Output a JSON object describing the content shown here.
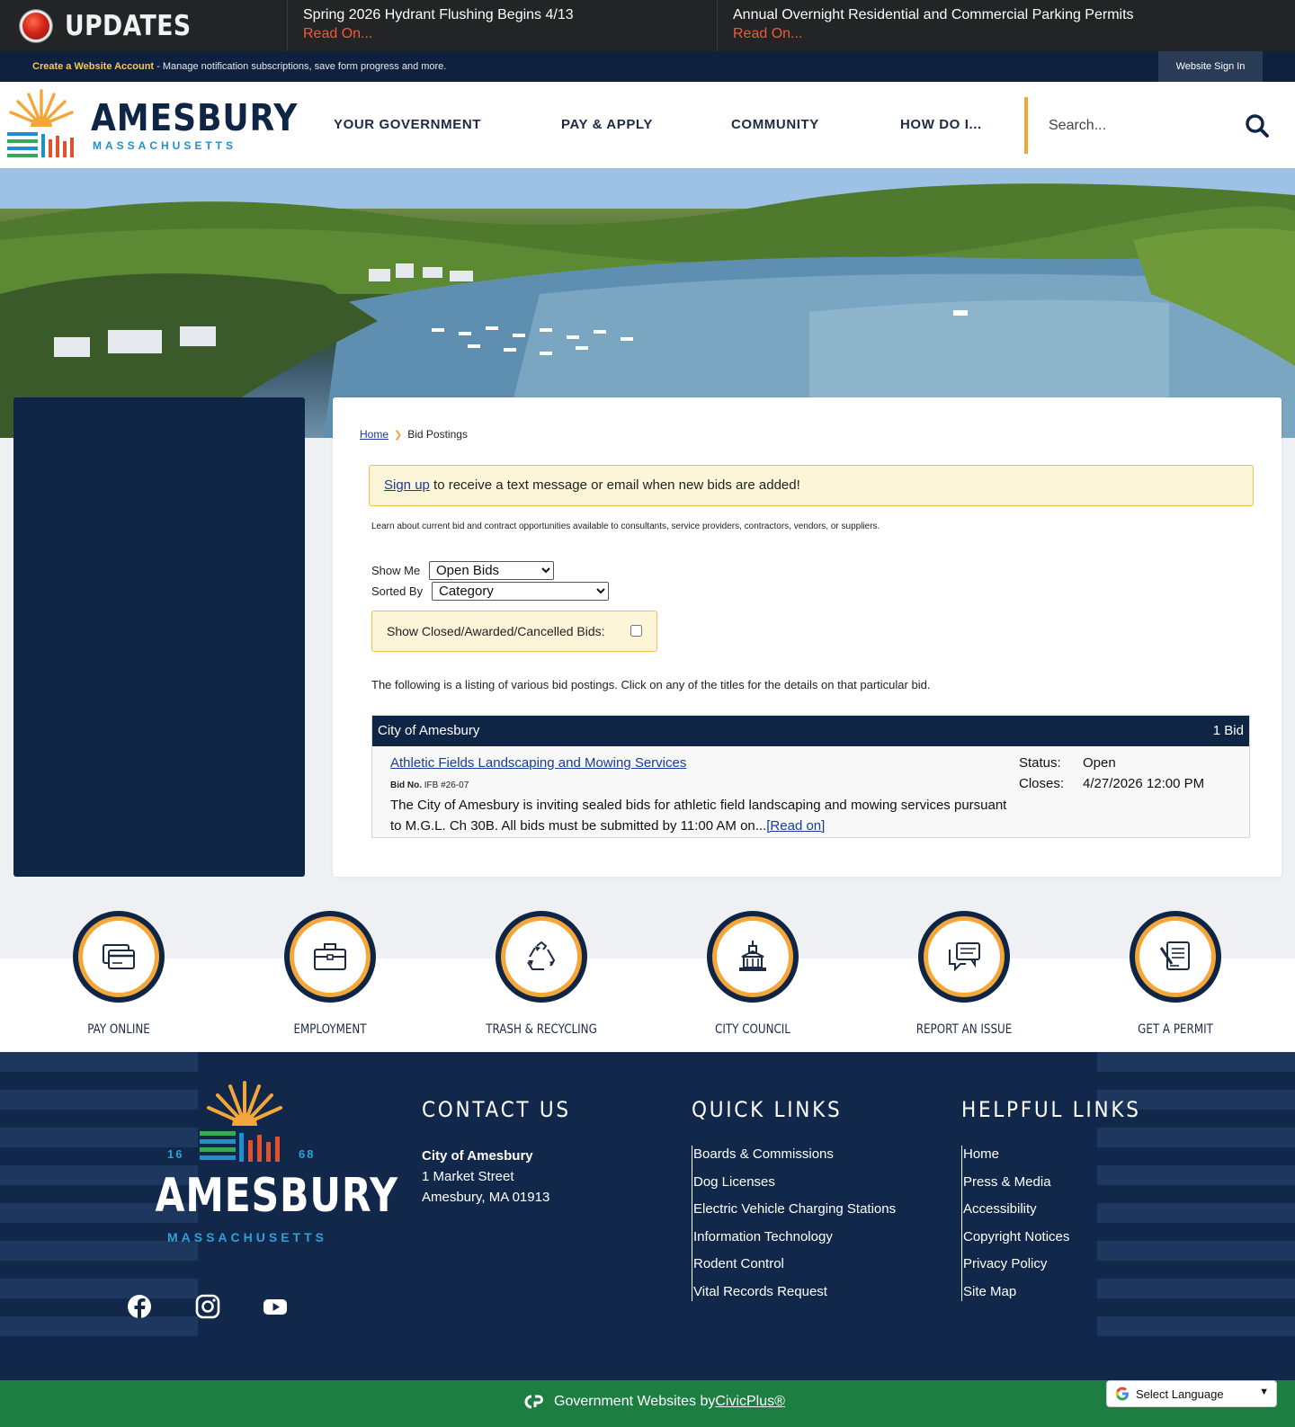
{
  "updates": {
    "label": "UPDATES",
    "items": [
      {
        "title": "Spring 2026 Hydrant Flushing Begins 4/13",
        "more": "Read On..."
      },
      {
        "title": "Annual Overnight Residential and Commercial Parking Permits",
        "more": "Read On..."
      }
    ]
  },
  "account_bar": {
    "create_link": "Create a Website Account",
    "description": " - Manage notification subscriptions, save form progress and more.",
    "sign_in": "Website Sign In"
  },
  "header": {
    "logo_word": "AMESBURY",
    "logo_sub": "MASSACHUSETTS",
    "nav": [
      "YOUR GOVERNMENT",
      "PAY & APPLY",
      "COMMUNITY",
      "HOW DO I..."
    ],
    "search_placeholder": "Search..."
  },
  "breadcrumb": {
    "home": "Home",
    "current": "Bid Postings"
  },
  "notice": {
    "link": "Sign up",
    "text": " to receive a text message or email when new bids are added!"
  },
  "intro": "Learn about current bid and contract opportunities available to consultants, service providers, contractors, vendors, or suppliers.",
  "filters": {
    "show_me_label": "Show Me",
    "show_me_value": "Open Bids",
    "sorted_by_label": "Sorted By",
    "sorted_by_value": "Category",
    "closed_label": "Show Closed/Awarded/Cancelled Bids:"
  },
  "listing_text": "The following is a listing of various bid postings. Click on any of the titles for the details on that particular bid.",
  "bid_group": {
    "name": "City of Amesbury",
    "count": "1 Bid",
    "bids": [
      {
        "title": "Athletic Fields Landscaping and Mowing Services",
        "bid_no_label": "Bid No.",
        "bid_no": "IFB #26-07",
        "description": "The City of Amesbury is inviting sealed bids for athletic field landscaping and mowing services pursuant to M.G.L. Ch 30B. All bids must be submitted by 11:00 AM on...",
        "read_on": "[Read on]",
        "status_label": "Status:",
        "status": "Open",
        "closes_label": "Closes:",
        "closes": "4/27/2026 12:00 PM"
      }
    ]
  },
  "quick_links": [
    {
      "label": "PAY ONLINE",
      "icon": "credit-card-icon"
    },
    {
      "label": "EMPLOYMENT",
      "icon": "briefcase-icon"
    },
    {
      "label": "TRASH & RECYCLING",
      "icon": "recycle-icon"
    },
    {
      "label": "CITY COUNCIL",
      "icon": "city-hall-icon"
    },
    {
      "label": "REPORT AN ISSUE",
      "icon": "chat-bubbles-icon"
    },
    {
      "label": "GET A PERMIT",
      "icon": "permit-document-icon"
    }
  ],
  "footer": {
    "logo_word": "AMESBURY",
    "logo_sub": "MASSACHUSETTS",
    "year_left": "16",
    "year_right": "68",
    "contact": {
      "heading": "CONTACT US",
      "name": "City of Amesbury",
      "address1": "1 Market Street",
      "address2": "Amesbury, MA 01913"
    },
    "quick": {
      "heading": "QUICK LINKS",
      "links": [
        "Boards & Commissions",
        "Dog Licenses",
        "Electric Vehicle Charging Stations",
        "Information Technology",
        "Rodent Control",
        "Vital Records Request"
      ]
    },
    "helpful": {
      "heading": "HELPFUL LINKS",
      "links": [
        "Home",
        "Press & Media",
        "Accessibility",
        "Copyright Notices",
        "Privacy Policy",
        "Site Map"
      ]
    },
    "social": [
      "facebook-icon",
      "instagram-icon",
      "youtube-icon"
    ]
  },
  "bottom_bar": {
    "text": "Government Websites by ",
    "link": "CivicPlus®"
  },
  "language": {
    "label": "Select Language"
  },
  "colors": {
    "navy": "#0f2546",
    "orange": "#f4a638",
    "green": "#1c7e41",
    "link_blue": "#1a3a9c",
    "notice_bg": "#fcf5d8"
  }
}
